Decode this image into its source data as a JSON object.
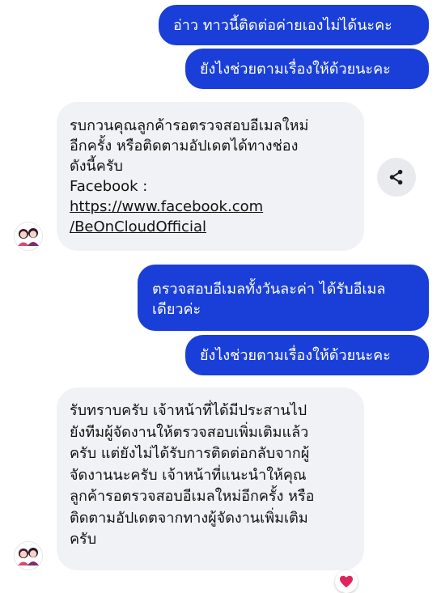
{
  "messages": [
    {
      "side": "out",
      "lines": [
        "อ่าว ทาวนี้ติดต่อค่ายเองไม่ได้นะคะ"
      ]
    },
    {
      "side": "out",
      "lines": [
        "ยังไงช่วยตามเรื่องให้ด้วยนะคะ"
      ]
    },
    {
      "side": "in",
      "lines": [
        "รบกวนคุณลูกค้ารอตรวจสอบอีเมลใหม่",
        "อีกครั้ง หรือติดตามอัปเดตได้ทางช่อง",
        "ดังนี้ครับ",
        "Facebook :",
        "https://www.facebook.com",
        "/BeOnCloudOfficial"
      ]
    },
    {
      "side": "out",
      "lines": [
        "ตรวจสอบอีเมลทั้งวันละค่า ได้รับอีเมล",
        "เดียวค่ะ"
      ]
    },
    {
      "side": "out",
      "lines": [
        "ยังไงช่วยตามเรื่องให้ด้วยนะคะ"
      ]
    },
    {
      "side": "in",
      "lines": [
        "รับทราบครับ เจ้าหน้าที่ได้มีประสานไป",
        "ยังทีมผู้จัดงานให้ตรวจสอบเพิ่มเติมแล้ว",
        "ครับ แต่ยังไม่ได้รับการติดต่อกลับจากผู้",
        "จัดงานนะครับ เจ้าหน้าที่แนะนำให้คุณ",
        "ลูกค้ารอตรวจสอบอีเมลใหม่อีกครั้ง หรือ",
        "ติดตามอัปเดตจากทางผู้จัดงานเพิ่มเติม",
        "ครับ"
      ]
    }
  ],
  "colors": {
    "outgoing_bubble": "#1a3fd8",
    "incoming_bubble": "#f1f2f5",
    "reaction": "#e0245e"
  },
  "icons": {
    "share": "share-icon",
    "reaction": "heart-icon",
    "avatar": "agent-avatar-icon"
  }
}
